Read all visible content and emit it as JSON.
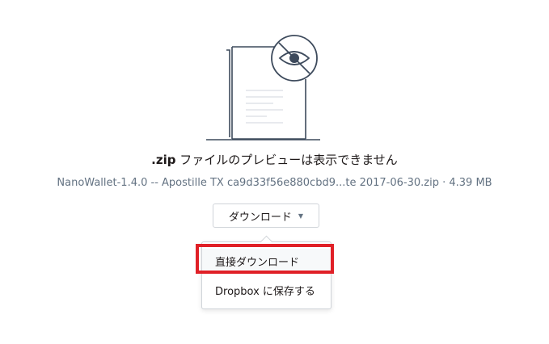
{
  "preview": {
    "title_ext": ".zip",
    "title_rest": " ファイルのプレビューは表示できません",
    "file_info": "NanoWallet-1.4.0 -- Apostille TX ca9d33f56e880cbd9...te 2017-06-30.zip · 4.39 MB"
  },
  "download": {
    "button_label": "ダウンロード",
    "caret": "▼",
    "menu": [
      {
        "label": "直接ダウンロード",
        "highlighted": true
      },
      {
        "label": "Dropbox に保存する",
        "highlighted": false
      }
    ]
  },
  "icons": {
    "illustration": "file-preview-unavailable-icon",
    "hidden-eye": "eye-slash-icon"
  },
  "colors": {
    "highlight": "#e02027",
    "illustration_stroke": "#3d4a5c",
    "meta_text": "#637282"
  }
}
